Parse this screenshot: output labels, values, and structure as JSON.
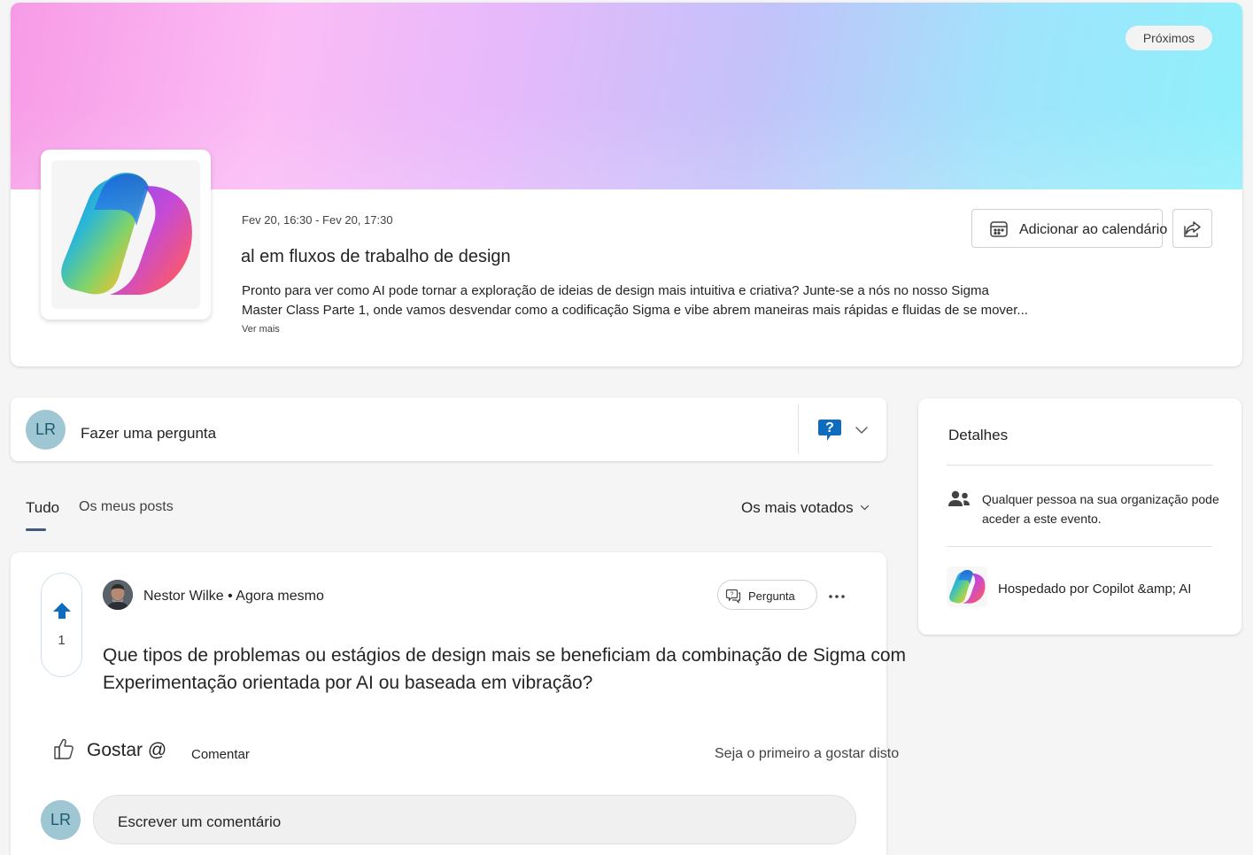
{
  "event": {
    "status_label": "Próximos",
    "date_range": "Fev 20, 16:30 - Fev 20, 17:30",
    "title": "al em fluxos de trabalho de design",
    "description_line1": "Pronto para ver como AI pode tornar a exploração de ideias de design mais intuitiva e criativa? Junte-se a nós no nosso Sigma",
    "description_line2": "Master Class Parte 1, onde vamos desvendar como a codificação Sigma e vibe abrem maneiras mais rápidas e fluidas de se mover...",
    "see_more": "Ver mais",
    "add_to_calendar": "Adicionar ao calendário"
  },
  "ask": {
    "avatar_initials": "LR",
    "placeholder": "Fazer uma pergunta"
  },
  "tabs": [
    {
      "label": "Tudo",
      "active": true
    },
    {
      "label": "Os meus posts",
      "active": false
    }
  ],
  "sort": {
    "selected": "Os mais votados"
  },
  "post": {
    "upvotes": "1",
    "author_line": "Nestor Wilke • Agora mesmo",
    "type_label": "Pergunta",
    "question_line1": "Que tipos de problemas ou estágios de design mais se beneficiam da combinação de Sigma com",
    "question_line2": "Experimentação orientada por AI ou baseada em vibração?",
    "like_label": "Gostar @",
    "comment_label": "Comentar",
    "first_like_text": "Seja o primeiro a gostar disto",
    "commenter_initials": "LR",
    "comment_placeholder": "Escrever um comentário"
  },
  "details": {
    "title": "Detalhes",
    "access_text": "Qualquer pessoa na sua organização pode aceder a este evento.",
    "host_text": "Hospedado por Copilot &amp; AI"
  },
  "colors": {
    "accent": "#3f5b77",
    "avatar_bg": "#9fc6d3",
    "upvote_blue": "#0f6cbd"
  }
}
